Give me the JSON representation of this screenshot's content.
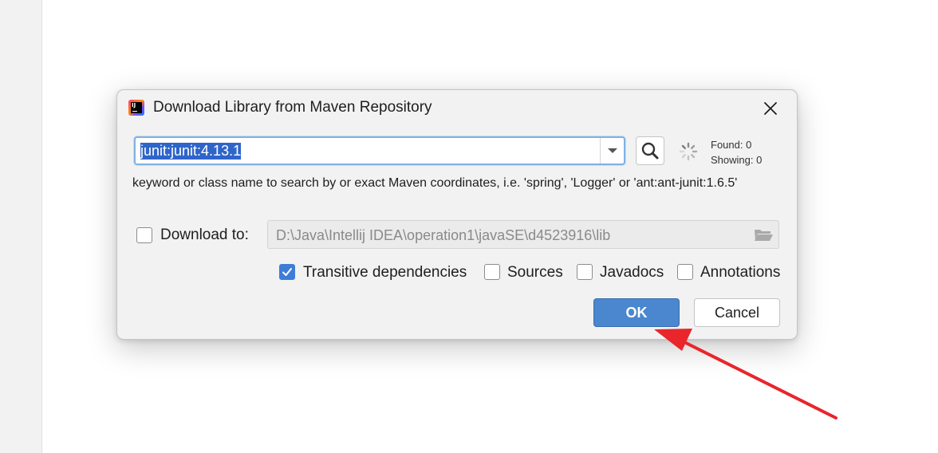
{
  "dialog": {
    "title": "Download Library from Maven Repository",
    "app_icon_text": "IJ",
    "search": {
      "value": "junit:junit:4.13.1"
    },
    "found_label": "Found: 0",
    "showing_label": "Showing: 0",
    "hint": "keyword or class name to search by or exact Maven coordinates, i.e. 'spring', 'Logger' or 'ant:ant-junit:1.6.5'",
    "download_to": {
      "label": "Download to:",
      "checked": false,
      "path": "D:\\Java\\Intellij IDEA\\operation1\\javaSE\\d4523916\\lib"
    },
    "options": [
      {
        "label": "Transitive dependencies",
        "checked": true
      },
      {
        "label": "Sources",
        "checked": false
      },
      {
        "label": "Javadocs",
        "checked": false
      },
      {
        "label": "Annotations",
        "checked": false
      }
    ],
    "buttons": {
      "ok": "OK",
      "cancel": "Cancel"
    }
  },
  "colors": {
    "accent": "#4a87cf",
    "annotation_arrow": "#e8262c"
  },
  "icons": [
    "app-icon",
    "close-icon",
    "chevron-down-icon",
    "search-icon",
    "loading-spinner-icon",
    "folder-icon",
    "checkmark-icon"
  ]
}
